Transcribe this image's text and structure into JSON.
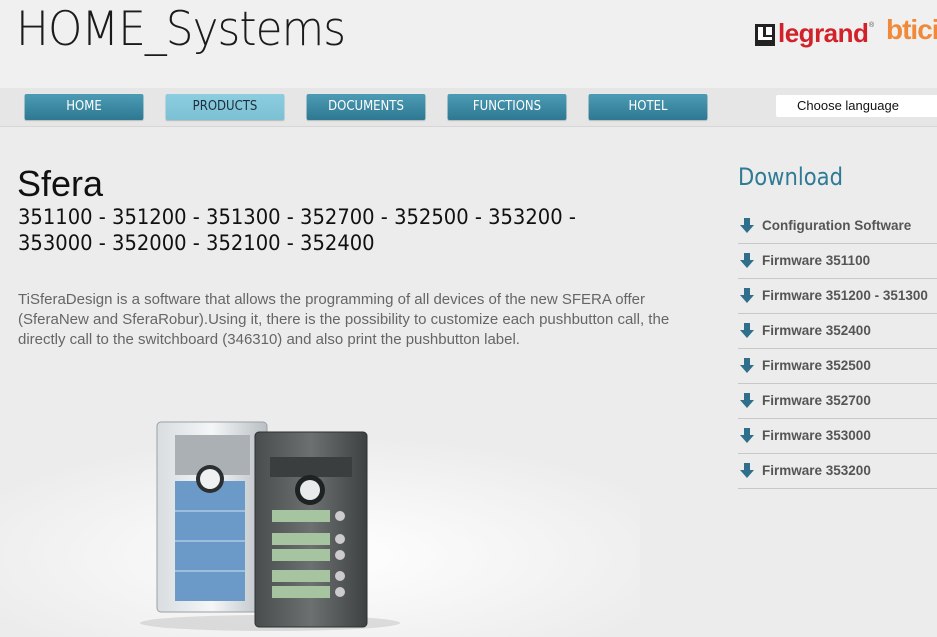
{
  "header": {
    "site_title": "HOME_Systems",
    "legrand_logo": "legrand",
    "bticino_logo": "bticino"
  },
  "nav": {
    "items": [
      {
        "label": "HOME",
        "active": false
      },
      {
        "label": "PRODUCTS",
        "active": true
      },
      {
        "label": "DOCUMENTS",
        "active": false
      },
      {
        "label": "FUNCTIONS",
        "active": false
      },
      {
        "label": "HOTEL",
        "active": false
      }
    ],
    "language_select": "Choose language"
  },
  "main": {
    "title": "Sfera",
    "codes": "351100 - 351200 - 351300 - 352700 - 352500 - 353200 - 353000 - 352000 - 352100 - 352400",
    "description": "TiSferaDesign is a software that allows the programming of all devices of the new SFERA offer (SferaNew and SferaRobur).Using it, there is the possibility to customize each pushbutton call, the directly call to the switchboard (346310) and also print the pushbutton label."
  },
  "sidebar": {
    "title": "Download",
    "items": [
      {
        "label": "Configuration Software",
        "icon": "download-arrow-icon"
      },
      {
        "label": "Firmware 351100",
        "icon": "download-arrow-icon"
      },
      {
        "label": "Firmware 351200 - 351300",
        "icon": "download-arrow-icon"
      },
      {
        "label": "Firmware 352400",
        "icon": "download-arrow-icon"
      },
      {
        "label": "Firmware 352500",
        "icon": "download-arrow-icon"
      },
      {
        "label": "Firmware 352700",
        "icon": "download-arrow-icon"
      },
      {
        "label": "Firmware 353000",
        "icon": "download-arrow-icon"
      },
      {
        "label": "Firmware 353200",
        "icon": "download-arrow-icon"
      }
    ]
  },
  "colors": {
    "nav_button": "#3a88a3",
    "nav_button_active": "#86c8dc",
    "accent_title": "#2f7a95",
    "legrand_red": "#d1222a",
    "bticino_orange": "#f08a3a"
  }
}
